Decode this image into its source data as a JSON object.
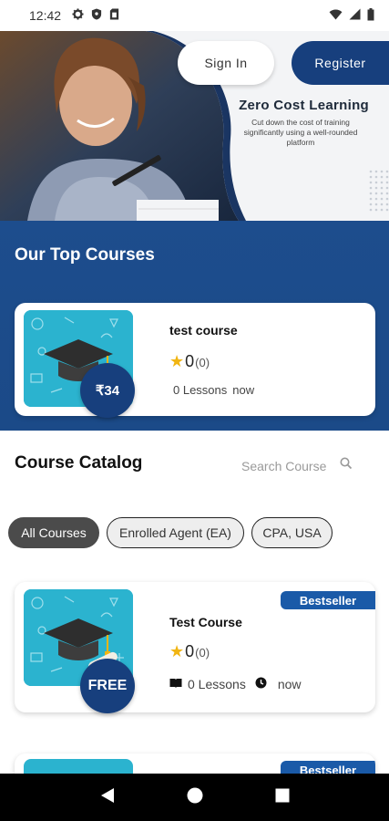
{
  "status_bar": {
    "time": "12:42"
  },
  "header": {
    "signin_label": "Sign In",
    "register_label": "Register"
  },
  "hero": {
    "title": "Zero Cost Learning",
    "subtitle": "Cut down the cost of training significantly using a well-rounded platform"
  },
  "top_courses": {
    "heading": "Our Top Courses",
    "items": [
      {
        "title": "test course",
        "price": "₹34",
        "rating": "0",
        "rating_count": "(0)",
        "lessons": "0 Lessons",
        "time": "now"
      }
    ]
  },
  "catalog": {
    "heading": "Course Catalog",
    "search_placeholder": "Search Course",
    "chips": [
      "All Courses",
      "Enrolled Agent (EA)",
      "CPA, USA"
    ],
    "active_chip": "All Courses",
    "items": [
      {
        "badge": "Bestseller",
        "title": "Test Course",
        "price": "FREE",
        "rating": "0",
        "rating_count": "(0)",
        "lessons": "0 Lessons",
        "time": "now"
      },
      {
        "badge": "Bestseller"
      }
    ]
  },
  "colors": {
    "primary": "#173f7d",
    "band": "#1d4d8d",
    "badge": "#1a5aa8",
    "star": "#f1b512",
    "thumb": "#2bb3cf"
  },
  "icons": [
    "gear-icon",
    "shield-icon",
    "sim-icon",
    "wifi-icon",
    "signal-icon",
    "battery-icon",
    "search-icon",
    "star-icon",
    "book-icon",
    "clock-icon",
    "back-icon",
    "home-icon",
    "recents-icon"
  ]
}
